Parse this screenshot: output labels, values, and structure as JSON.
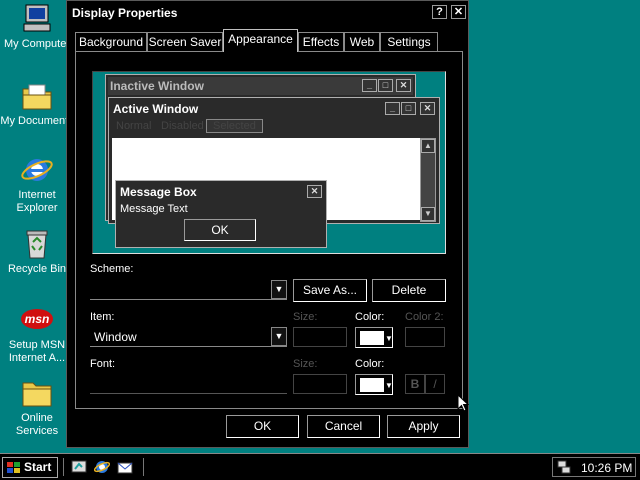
{
  "desktop": {
    "icons": [
      {
        "label": "My Computer",
        "icon": "computer-icon"
      },
      {
        "label": "My Documents",
        "icon": "folder-documents-icon"
      },
      {
        "label": "Internet Explorer",
        "icon": "internet-explorer-icon"
      },
      {
        "label": "Recycle Bin",
        "icon": "recycle-bin-icon"
      },
      {
        "label": "Setup MSN Internet A...",
        "icon": "msn-icon"
      },
      {
        "label": "Online Services",
        "icon": "folder-icon"
      }
    ]
  },
  "dialog": {
    "title": "Display Properties",
    "help_glyph": "?",
    "close_glyph": "✕",
    "tabs": [
      "Background",
      "Screen Saver",
      "Appearance",
      "Effects",
      "Web",
      "Settings"
    ],
    "active_tab": "Appearance",
    "preview": {
      "inactive_title": "Inactive Window",
      "active_title": "Active Window",
      "menu_normal": "Normal",
      "menu_disabled": "Disabled",
      "menu_selected": "Selected",
      "msgbox_title": "Message Box",
      "msgbox_text": "Message Text",
      "msgbox_ok": "OK"
    },
    "scheme_label": "Scheme:",
    "scheme_value": "",
    "save_as": "Save As...",
    "delete": "Delete",
    "item_label": "Item:",
    "item_value": "Window",
    "size_label": "Size:",
    "color_label": "Color:",
    "color2_label": "Color 2:",
    "font_label": "Font:",
    "font_size_label": "Size:",
    "font_color_label": "Color:",
    "bold_glyph": "B",
    "italic_glyph": "/",
    "ok": "OK",
    "cancel": "Cancel",
    "apply": "Apply"
  },
  "taskbar": {
    "start": "Start",
    "clock": "10:26 PM",
    "quick_launch": [
      "show-desktop-icon",
      "internet-explorer-icon",
      "outlook-express-icon"
    ]
  }
}
